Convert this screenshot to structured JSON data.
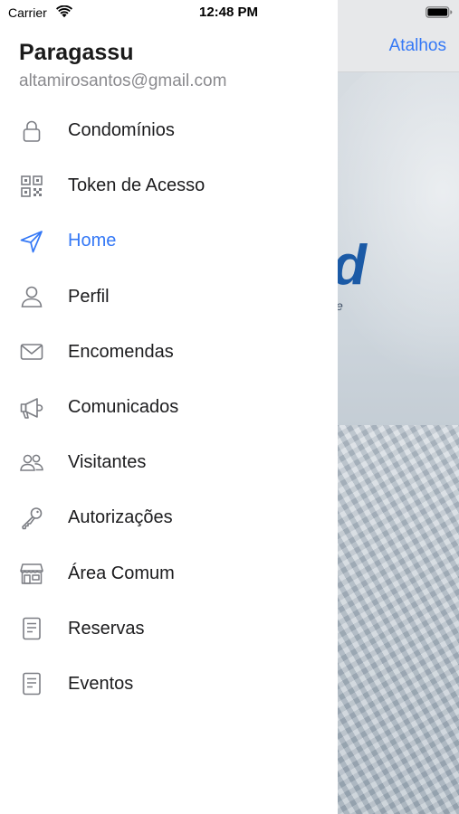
{
  "status_bar": {
    "carrier": "Carrier",
    "time": "12:48 PM"
  },
  "profile": {
    "name": "Paragassu",
    "email": "altamirosantos@gmail.com"
  },
  "background_app": {
    "nav_button": "Atalhos",
    "logo_fragment": "d",
    "logo_sub_fragment": "e"
  },
  "colors": {
    "accent": "#3478f6",
    "icon_gray": "#7b7d83",
    "text": "#1c1c1e",
    "secondary_text": "#8a8a8e"
  },
  "menu": {
    "active_index": 2,
    "items": [
      {
        "label": "Condomínios",
        "icon": "lock-icon"
      },
      {
        "label": "Token de Acesso",
        "icon": "qr-code-icon"
      },
      {
        "label": "Home",
        "icon": "paper-plane-icon"
      },
      {
        "label": "Perfil",
        "icon": "person-icon"
      },
      {
        "label": "Encomendas",
        "icon": "envelope-icon"
      },
      {
        "label": "Comunicados",
        "icon": "megaphone-icon"
      },
      {
        "label": "Visitantes",
        "icon": "people-icon"
      },
      {
        "label": "Autorizações",
        "icon": "key-icon"
      },
      {
        "label": "Área Comum",
        "icon": "storefront-icon"
      },
      {
        "label": "Reservas",
        "icon": "document-icon"
      },
      {
        "label": "Eventos",
        "icon": "document-icon"
      }
    ]
  }
}
